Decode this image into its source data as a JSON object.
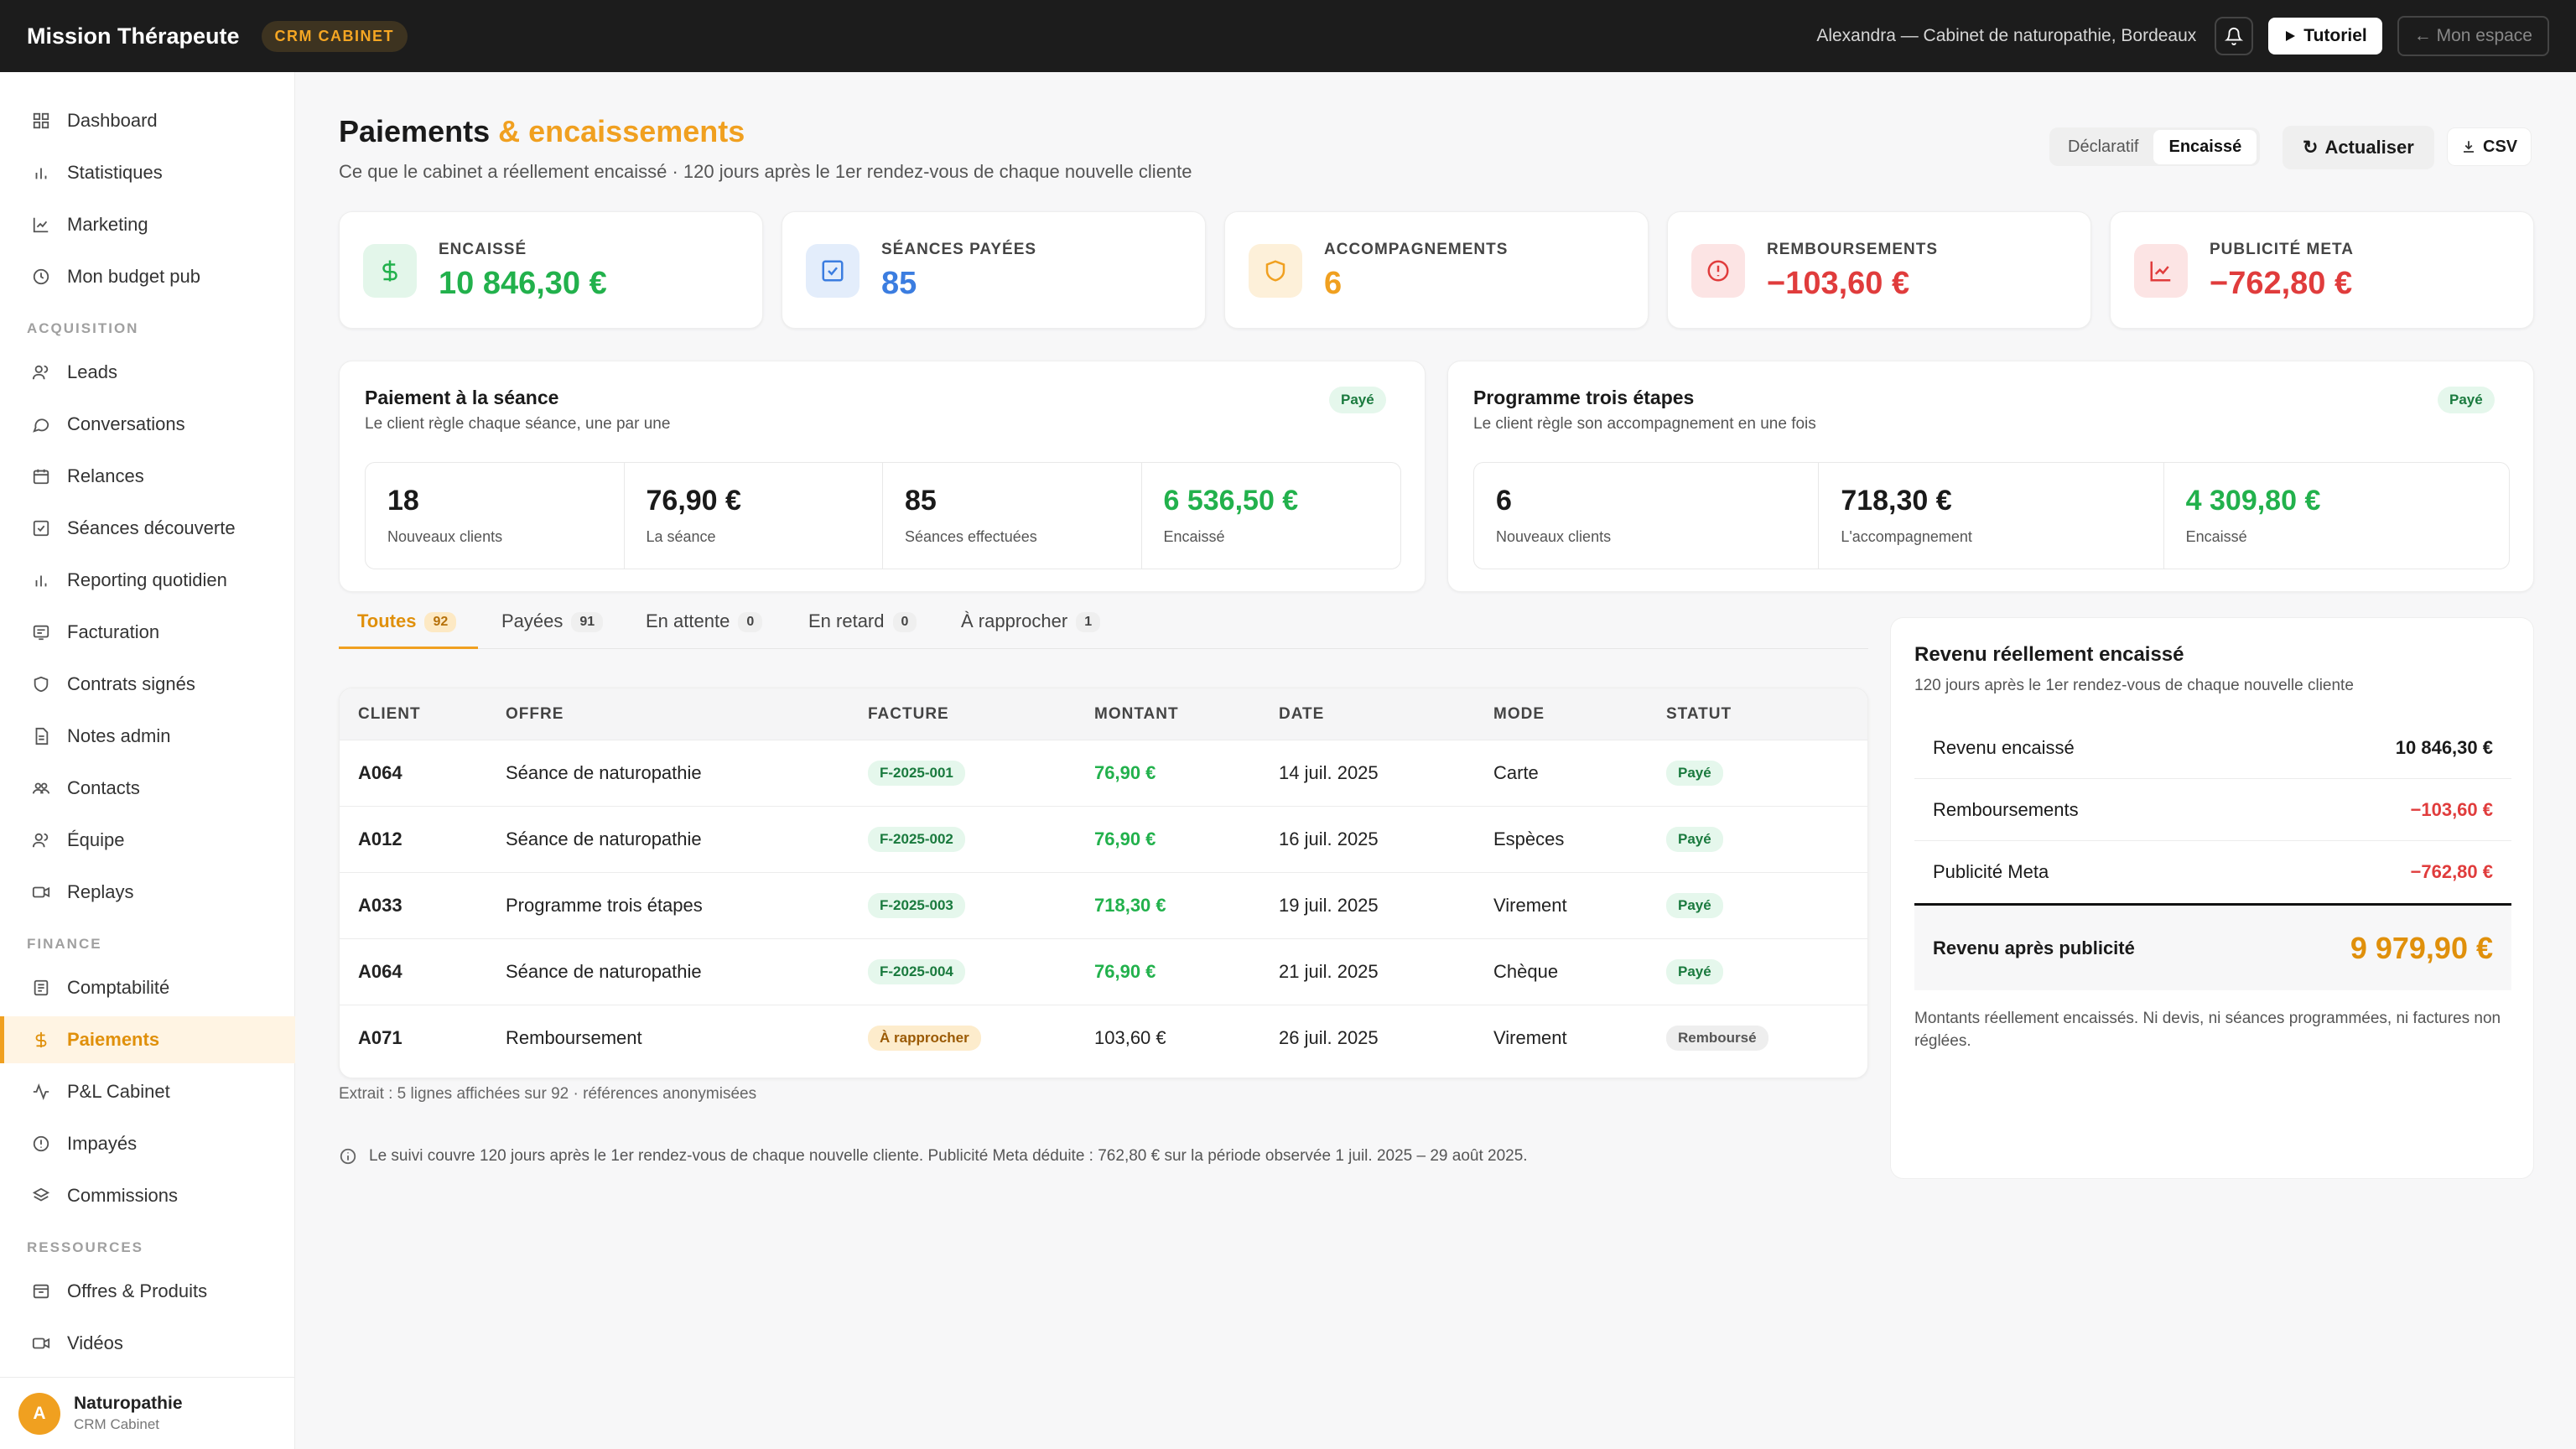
{
  "topbar": {
    "brand": "Mission Thérapeute",
    "badge": "CRM CABINET",
    "user": "Alexandra — Cabinet de naturopathie, Bordeaux",
    "tutorial": "Tutoriel",
    "my_space": "← Mon espace"
  },
  "sidebar": {
    "items_top": [
      "Dashboard",
      "Statistiques",
      "Marketing",
      "Mon budget pub"
    ],
    "section_acquisition": "ACQUISITION",
    "items_acquisition": [
      "Leads",
      "Conversations",
      "Relances",
      "Séances découverte",
      "Reporting quotidien",
      "Facturation",
      "Contrats signés",
      "Notes admin",
      "Contacts",
      "Équipe",
      "Replays"
    ],
    "section_finance": "FINANCE",
    "items_finance": [
      "Comptabilité",
      "Paiements",
      "P&L Cabinet",
      "Impayés",
      "Commissions"
    ],
    "section_ressources": "RESSOURCES",
    "items_ressources": [
      "Offres & Produits",
      "Vidéos"
    ],
    "footer": {
      "initial": "A",
      "name": "Naturopathie",
      "sub": "CRM Cabinet"
    }
  },
  "header": {
    "title_main": "Paiements",
    "title_accent": "& encaissements",
    "subtitle": "Ce que le cabinet a réellement encaissé · 120 jours après le 1er rendez-vous de chaque nouvelle cliente",
    "toggle": [
      "Déclaratif",
      "Encaissé"
    ],
    "refresh": "Actualiser",
    "csv": "CSV"
  },
  "kpis": [
    {
      "label": "ENCAISSÉ",
      "value": "10 846,30 €",
      "color": "#22b14c",
      "icon": "dollar-icon"
    },
    {
      "label": "SÉANCES PAYÉES",
      "value": "85",
      "color": "#3b7de0",
      "icon": "check-square-icon"
    },
    {
      "label": "ACCOMPAGNEMENTS",
      "value": "6",
      "color": "#f0a020",
      "icon": "shield-icon"
    },
    {
      "label": "REMBOURSEMENTS",
      "value": "−103,60 €",
      "color": "#e03c3c",
      "icon": "alert-circle-icon"
    },
    {
      "label": "PUBLICITÉ META",
      "value": "−762,80 €",
      "color": "#e03c3c",
      "icon": "chart-icon"
    }
  ],
  "card_seance": {
    "title": "Paiement à la séance",
    "sub": "Le client règle chaque séance, une par une",
    "pill": "Payé",
    "stats": [
      {
        "value": "18",
        "label": "Nouveaux clients"
      },
      {
        "value": "76,90 €",
        "label": "La séance"
      },
      {
        "value": "85",
        "label": "Séances effectuées"
      },
      {
        "value": "6 536,50 €",
        "label": "Encaissé"
      }
    ]
  },
  "card_programme": {
    "title": "Programme trois étapes",
    "sub": "Le client règle son accompagnement en une fois",
    "pill": "Payé",
    "stats": [
      {
        "value": "6",
        "label": "Nouveaux clients"
      },
      {
        "value": "718,30 €",
        "label": "L'accompagnement"
      },
      {
        "value": "4 309,80 €",
        "label": "Encaissé"
      }
    ]
  },
  "tabs": [
    {
      "label": "Toutes",
      "count": "92"
    },
    {
      "label": "Payées",
      "count": "91"
    },
    {
      "label": "En attente",
      "count": "0"
    },
    {
      "label": "En retard",
      "count": "0"
    },
    {
      "label": "À rapprocher",
      "count": "1"
    }
  ],
  "table": {
    "columns": [
      "CLIENT",
      "OFFRE",
      "FACTURE",
      "MONTANT",
      "DATE",
      "MODE",
      "STATUT"
    ],
    "rows": [
      {
        "client": "A064",
        "offre": "Séance de naturopathie",
        "facture": "F-2025-001",
        "montant": "76,90 €",
        "date": "14 juil. 2025",
        "mode": "Carte",
        "statut": "Payé"
      },
      {
        "client": "A012",
        "offre": "Séance de naturopathie",
        "facture": "F-2025-002",
        "montant": "76,90 €",
        "date": "16 juil. 2025",
        "mode": "Espèces",
        "statut": "Payé"
      },
      {
        "client": "A033",
        "offre": "Programme trois étapes",
        "facture": "F-2025-003",
        "montant": "718,30 €",
        "date": "19 juil. 2025",
        "mode": "Virement",
        "statut": "Payé"
      },
      {
        "client": "A064",
        "offre": "Séance de naturopathie",
        "facture": "F-2025-004",
        "montant": "76,90 €",
        "date": "21 juil. 2025",
        "mode": "Chèque",
        "statut": "Payé"
      },
      {
        "client": "A071",
        "offre": "Remboursement",
        "facture": "À rapprocher",
        "montant": "103,60 €",
        "date": "26 juil. 2025",
        "mode": "Virement",
        "statut": "Remboursé"
      }
    ],
    "extract": "Extrait : 5 lignes affichées sur 92 · références anonymisées"
  },
  "info_note": "Le suivi couvre 120 jours après le 1er rendez-vous de chaque nouvelle cliente. Publicité Meta déduite : 762,80 € sur la période observée 1 juil. 2025 – 29 août 2025.",
  "revenue": {
    "title": "Revenu réellement encaissé",
    "sub": "120 jours après le 1er rendez-vous de chaque nouvelle cliente",
    "rows": [
      {
        "label": "Revenu encaissé",
        "value": "10 846,30 €"
      },
      {
        "label": "Remboursements",
        "value": "−103,60 €"
      },
      {
        "label": "Publicité Meta",
        "value": "−762,80 €"
      }
    ],
    "total_label": "Revenu après publicité",
    "total_value": "9 979,90 €",
    "note": "Montants réellement encaissés. Ni devis, ni séances programmées, ni factures non réglées."
  }
}
